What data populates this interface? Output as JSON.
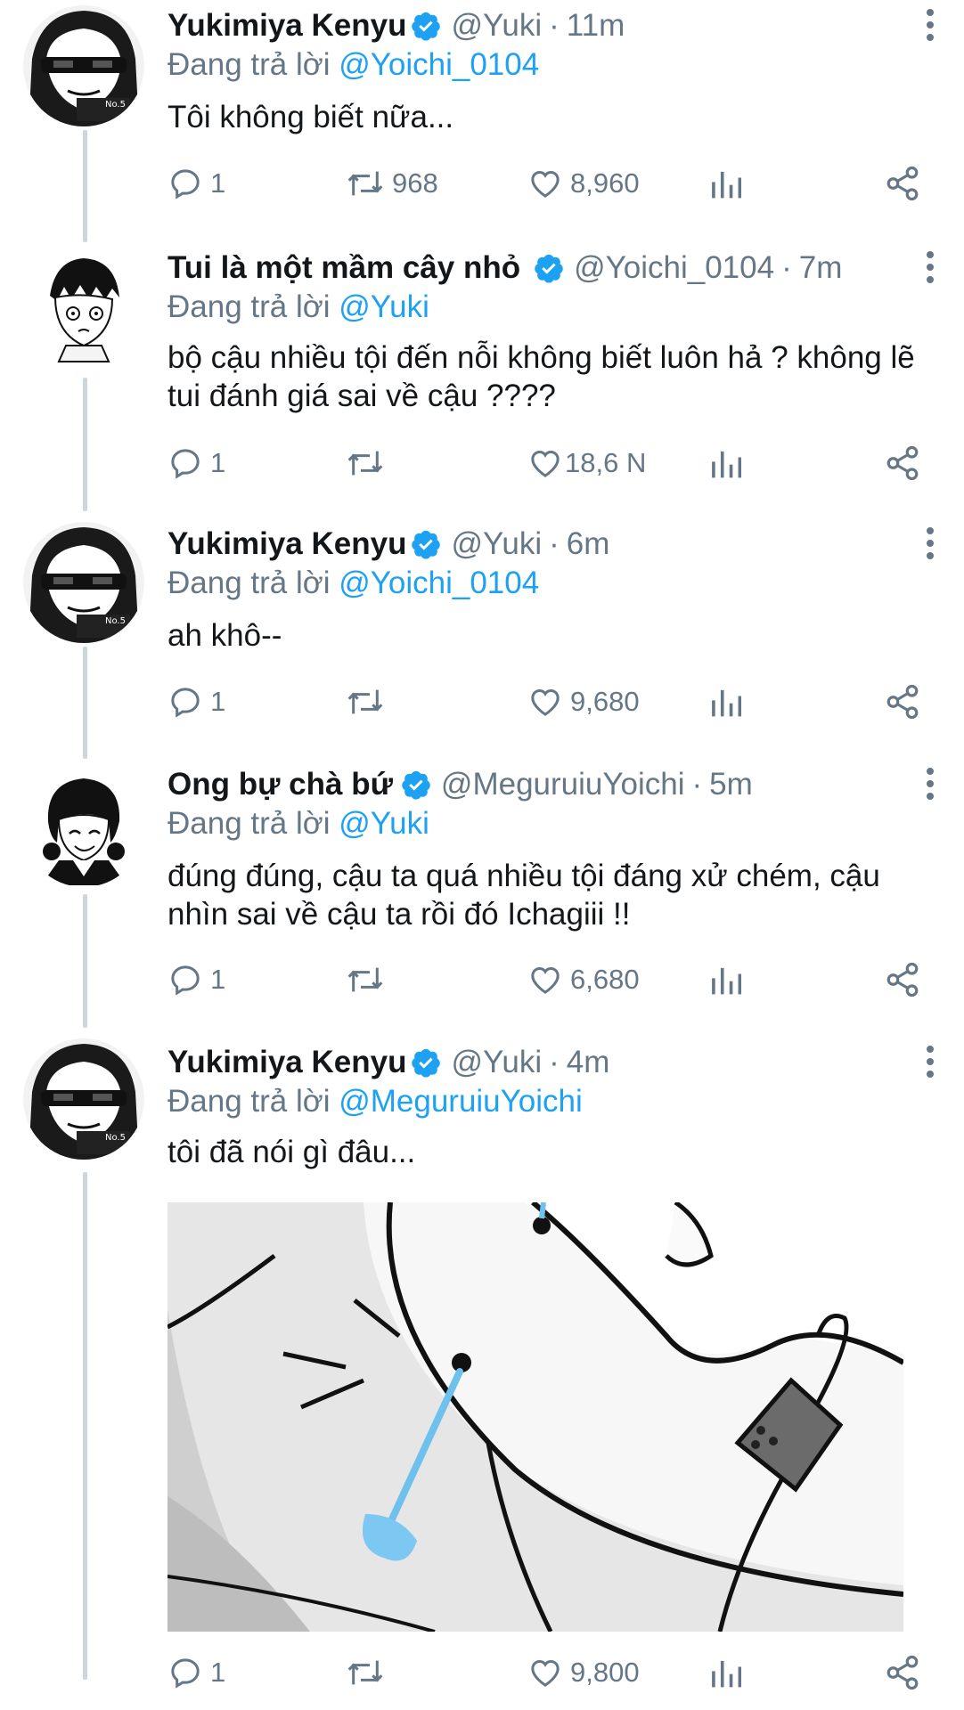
{
  "tweets": [
    {
      "name": "Yukimiya Kenyu",
      "handle": "@Yuki",
      "separator": "·",
      "time": "11m",
      "reply_prefix": "Đang trả lời",
      "reply_to": "@Yoichi_0104",
      "text": "Tôi không biết nữa...",
      "replies": "1",
      "retweets": "968",
      "likes": "8,960"
    },
    {
      "name": "Tui là một mầm cây nhỏ",
      "handle": "@Yoichi_0104",
      "separator": "·",
      "time": "7m",
      "reply_prefix": "Đang trả lời",
      "reply_to": "@Yuki",
      "text": "bộ cậu nhiều tội đến nỗi không biết luôn hả ? không lẽ tui đánh giá sai về cậu ????",
      "replies": "1",
      "retweets": "",
      "likes": "18,6 N"
    },
    {
      "name": "Yukimiya Kenyu",
      "handle": "@Yuki",
      "separator": "·",
      "time": "6m",
      "reply_prefix": "Đang trả lời",
      "reply_to": "@Yoichi_0104",
      "text": "ah khô--",
      "replies": "1",
      "retweets": "",
      "likes": "9,680"
    },
    {
      "name": "Ong bự chà bứ",
      "handle": "@MeguruiuYoichi",
      "separator": "·",
      "time": "5m",
      "reply_prefix": "Đang trả lời",
      "reply_to": "@Yuki",
      "text": "đúng đúng, cậu ta quá nhiều tội đáng xử chém, cậu nhìn sai về cậu ta rồi đó Ichagiii !!",
      "replies": "1",
      "retweets": "",
      "likes": "6,680"
    },
    {
      "name": "Yukimiya Kenyu",
      "handle": "@Yuki",
      "separator": "·",
      "time": "4m",
      "reply_prefix": "Đang trả lời",
      "reply_to": "@MeguruiuYoichi",
      "text": "tôi đã nói gì đâu...",
      "replies": "1",
      "retweets": "",
      "likes": "9,800"
    }
  ],
  "colors": {
    "accent": "#1da1f2",
    "secondary_text": "#657786",
    "primary_text": "#14171a",
    "thread_line": "#ccd6dd"
  },
  "icons": {
    "verified": "verified-badge-icon",
    "more": "more-vertical-icon",
    "reply": "reply-bubble-icon",
    "retweet": "retweet-icon",
    "like": "heart-icon",
    "analytics": "analytics-bars-icon",
    "share": "share-icon"
  }
}
